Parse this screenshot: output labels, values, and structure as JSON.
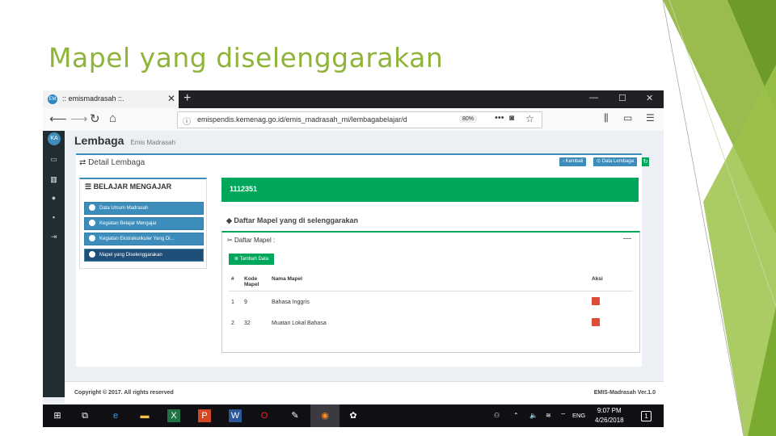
{
  "slide": {
    "title": "Mapel yang diselenggarakan"
  },
  "colors": {
    "accent_green": "#8fb43a",
    "app_blue": "#3c8dbc",
    "success_green": "#00a65a",
    "danger_red": "#dd4b39",
    "sidebar_dark": "#222d32"
  },
  "browser": {
    "tab_title": ":: emismadrasah ::.",
    "tab_favicon_text": "EM",
    "address_url": "emispendis.kemenag.go.id/emis_madrasah_mi/lembagabelajar/d",
    "zoom_label": "80%",
    "more_label": "•••",
    "icons": [
      "back-icon",
      "forward-icon",
      "reload-icon",
      "home-icon",
      "info-icon",
      "pocket-icon",
      "star-icon",
      "library-icon",
      "reader-icon",
      "menu-icon"
    ]
  },
  "app": {
    "avatar_initials": "KA",
    "header_title": "Lembaga",
    "header_subtitle": "Emis Madrasah",
    "box_title": "Detail Lembaga",
    "btn_back": "Kembali",
    "btn_data": "Data Lembaga",
    "left_panel": {
      "title": "BELAJAR MENGAJAR",
      "items": [
        {
          "label": "Data Umum Madrasah"
        },
        {
          "label": "Kegiatan Belajar Mengajar"
        },
        {
          "label": "Kegiatan Ekstrakurikuler Yang Di..."
        },
        {
          "label": "Mapel yang Diselenggarakan"
        }
      ]
    },
    "green_bar_id": "1112351",
    "section_heading": "Daftar Mapel yang di selenggarakan",
    "list_panel": {
      "title": "Daftar Mapel :",
      "add_button": "Tambah Data",
      "columns": [
        "#",
        "Kode Mapel",
        "Nama Mapel",
        "Aksi"
      ],
      "rows": [
        {
          "no": "1",
          "kode": "9",
          "nama": "Bahasa Inggris"
        },
        {
          "no": "2",
          "kode": "32",
          "nama": "Muatan Lokal Bahasa"
        }
      ]
    },
    "footer_left": "Copyright © 2017. All rights reserved",
    "footer_right": "EMIS-Madrasah Ver.1.0"
  },
  "taskbar": {
    "language": "ENG",
    "time": "9:07 PM",
    "date": "4/26/2018",
    "notification_count": "1"
  }
}
